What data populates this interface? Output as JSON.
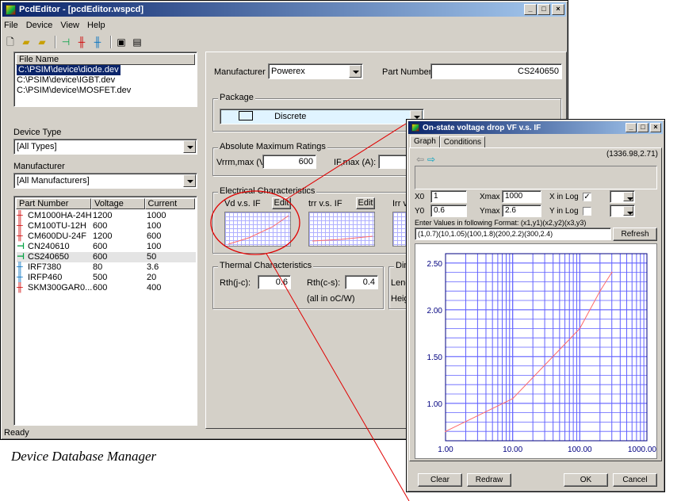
{
  "main": {
    "title": "PcdEditor - [pcdEditor.wspcd]",
    "menu": [
      "File",
      "Device",
      "View",
      "Help"
    ],
    "file_list": {
      "header": "File Name",
      "items": [
        "C:\\PSIM\\device\\diode.dev",
        "C:\\PSIM\\device\\IGBT.dev",
        "C:\\PSIM\\device\\MOSFET.dev"
      ]
    },
    "device_type": {
      "label": "Device Type",
      "value": "[All Types]"
    },
    "manufacturer_filter": {
      "label": "Manufacturer",
      "value": "[All Manufacturers]"
    },
    "parts": {
      "headers": [
        "Part Number",
        "Voltage",
        "Current"
      ],
      "rows": [
        {
          "icon": "igbt-icon",
          "part": "CM1000HA-24H",
          "voltage": "1200",
          "current": "1000"
        },
        {
          "icon": "igbt-icon",
          "part": "CM100TU-12H",
          "voltage": "600",
          "current": "100"
        },
        {
          "icon": "igbt-icon",
          "part": "CM600DU-24F",
          "voltage": "1200",
          "current": "600"
        },
        {
          "icon": "diode-icon",
          "part": "CN240610",
          "voltage": "600",
          "current": "100"
        },
        {
          "icon": "diode-icon",
          "part": "CS240650",
          "voltage": "600",
          "current": "50"
        },
        {
          "icon": "mosfet-icon",
          "part": "IRF7380",
          "voltage": "80",
          "current": "3.6"
        },
        {
          "icon": "mosfet-icon",
          "part": "IRFP460",
          "voltage": "500",
          "current": "20"
        },
        {
          "icon": "igbt-icon",
          "part": "SKM300GAR0...",
          "voltage": "600",
          "current": "400"
        }
      ]
    },
    "status": "Ready",
    "detail": {
      "manufacturer_label": "Manufacturer",
      "manufacturer_value": "Powerex",
      "part_number_label": "Part Number",
      "part_number_value": "CS240650",
      "package_title": "Package",
      "package_value": "Discrete",
      "abs_max_title": "Absolute Maximum Ratings",
      "vrrm_label": "Vrrm,max (V):",
      "vrrm_value": "600",
      "ifmax_label": "IF,max (A):",
      "elec_title": "Electrical Characteristics",
      "vd_label": "Vd v.s. IF",
      "trr_label": "trr v.s. IF",
      "irr_label": "Irr v.s",
      "edit_label": "Edit",
      "thermal_title": "Thermal Characteristics",
      "rthjc_label": "Rth(j-c):",
      "rthjc_value": "0.6",
      "rthcs_label": "Rth(c-s):",
      "rthcs_value": "0.4",
      "thermal_note": "(all in oC/W)",
      "dim_title": "Dime",
      "len_label": "Leng",
      "hei_label": "Heig"
    }
  },
  "caption": "Device Database Manager",
  "graph_win": {
    "title": "On-state voltage drop VF v.s. IF",
    "tabs": [
      "Graph",
      "Conditions"
    ],
    "coord": "(1336.98,2.71)",
    "x0_label": "X0",
    "x0_value": "1",
    "xmax_label": "Xmax",
    "xmax_value": "1000",
    "xlog_label": "X in Log",
    "y0_label": "Y0",
    "y0_value": "0.6",
    "ymax_label": "Ymax",
    "ymax_value": "2.6",
    "ylog_label": "Y in Log",
    "format_hint": "Enter Values in following Format:  (x1,y1)(x2,y2)(x3,y3)",
    "values_text": "(1,0.7)(10,1.05)(100,1.8)(200,2.2)(300,2.4)",
    "refresh_label": "Refresh",
    "clear_label": "Clear",
    "redraw_label": "Redraw",
    "ok_label": "OK",
    "cancel_label": "Cancel"
  },
  "chart_data": {
    "type": "line",
    "x": [
      1,
      10,
      100,
      200,
      300
    ],
    "values": [
      0.7,
      1.05,
      1.8,
      2.2,
      2.4
    ],
    "xlim": [
      1,
      1000
    ],
    "ylim": [
      0.6,
      2.6
    ],
    "x_scale": "log",
    "x_tick_labels": [
      "1.00",
      "10.00",
      "100.00",
      "1000.00"
    ],
    "y_tick_labels": [
      "1.00",
      "1.50",
      "2.00",
      "2.50"
    ],
    "y_ticks": [
      1.0,
      1.5,
      2.0,
      2.5
    ],
    "grid": true,
    "line_color": "#ff6a6a",
    "grid_color": "#6060ff"
  }
}
